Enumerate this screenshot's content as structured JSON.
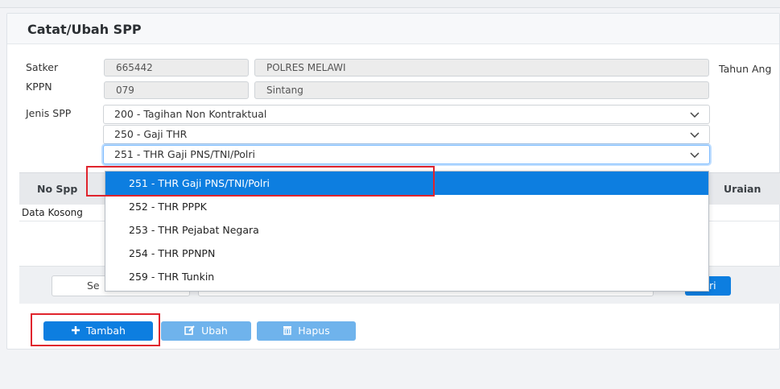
{
  "card": {
    "title": "Catat/Ubah SPP"
  },
  "form": {
    "satker_label": "Satker",
    "satker_code": "665442",
    "satker_name": "POLRES MELAWI",
    "tahun_label": "Tahun Ang",
    "kppn_label": "KPPN",
    "kppn_code": "079",
    "kppn_name": "Sintang",
    "jenis_label": "Jenis SPP",
    "jenis_select_1": "200 - Tagihan Non Kontraktual",
    "jenis_select_2": "250 - Gaji THR",
    "jenis_select_3": "251 - THR Gaji PNS/TNI/Polri"
  },
  "table": {
    "col_no_spp": "No Spp",
    "col_uraian": "Uraian",
    "empty_text": "Data Kosong"
  },
  "filter": {
    "search_text": "Se",
    "search_button_tail": "ri"
  },
  "dropdown": {
    "options": [
      "251 - THR Gaji PNS/TNI/Polri",
      "252 - THR PPPK",
      "253 - THR Pejabat Negara",
      "254 - THR PPNPN",
      "259 - THR Tunkin"
    ],
    "selected_index": 0
  },
  "actions": {
    "tambah_label": "Tambah",
    "ubah_label": "Ubah",
    "hapus_label": "Hapus"
  },
  "colors": {
    "primary": "#0d7ee0",
    "primary_light": "#6fb3ec",
    "highlight_red": "#e0242d"
  },
  "icons": {
    "tambah": "plus-icon",
    "ubah": "edit-icon",
    "hapus": "trash-icon",
    "select": "chevron-down-icon"
  }
}
